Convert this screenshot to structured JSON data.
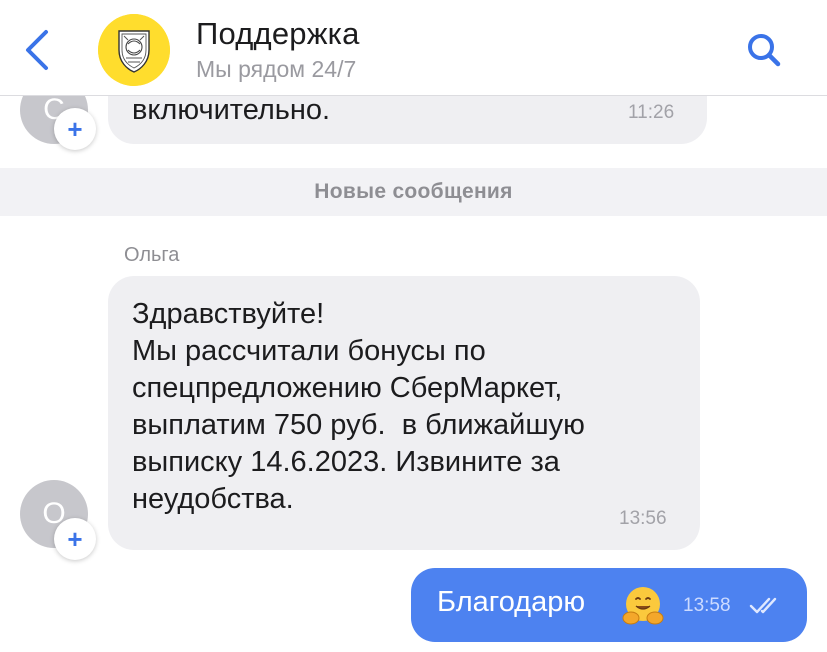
{
  "header": {
    "title": "Поддержка",
    "subtitle": "Мы рядом 24/7",
    "back_icon": "chevron-left-icon",
    "search_icon": "search-icon",
    "logo": "bank-emblem-logo",
    "accent_color": "#3a73e8",
    "logo_color": "#ffdd2d"
  },
  "messages_prev": {
    "avatar_letter": "С",
    "text": "включительно.",
    "time": "11:26"
  },
  "divider": {
    "label": "Новые сообщения"
  },
  "message_incoming": {
    "sender": "Ольга",
    "avatar_letter": "О",
    "lines": [
      "Здравствуйте!",
      "Мы рассчитали бонусы по",
      "спецпредложению СберМаркет,",
      "выплатим 750 руб.  в ближайшую",
      "выписку 14.6.2023. Извините за",
      "неудобства."
    ],
    "time": "13:56"
  },
  "message_outgoing": {
    "text": "Благодарю",
    "emoji": "hugging-face-emoji",
    "time": "13:58",
    "status_icon": "double-check-icon",
    "bubble_color": "#4d82f0"
  }
}
